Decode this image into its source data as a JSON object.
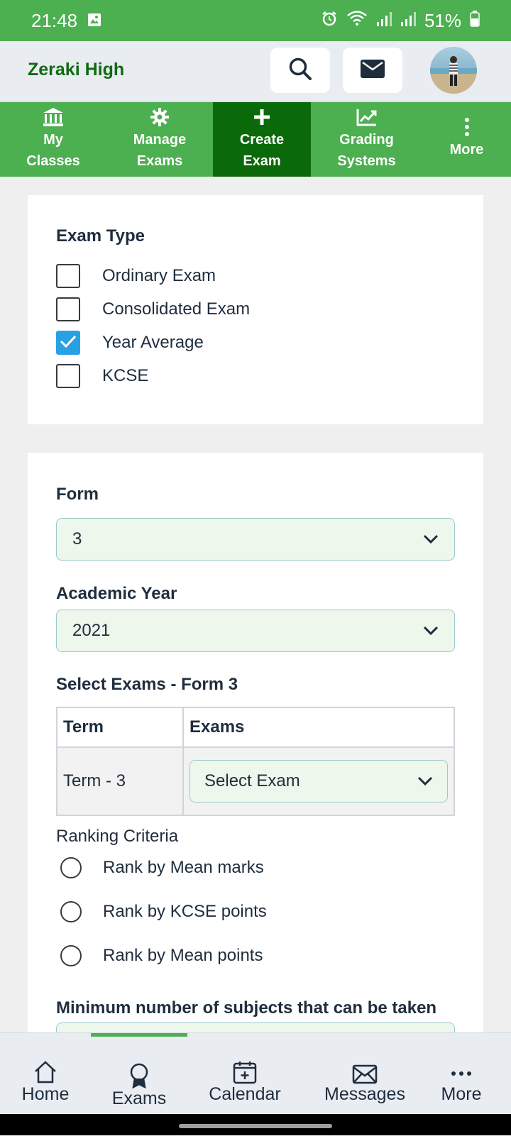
{
  "status_bar": {
    "time": "21:48",
    "battery": "51%"
  },
  "header": {
    "school_name": "Zeraki High"
  },
  "top_tabs": [
    {
      "line1": "My",
      "line2": "Classes",
      "icon": "bank-icon"
    },
    {
      "line1": "Manage",
      "line2": "Exams",
      "icon": "gear-icon"
    },
    {
      "line1": "Create",
      "line2": "Exam",
      "icon": "plus-icon",
      "active": true
    },
    {
      "line1": "Grading",
      "line2": "Systems",
      "icon": "chart-icon"
    },
    {
      "line1": "More",
      "line2": "",
      "icon": "vertical-dots-icon"
    }
  ],
  "exam_type": {
    "title": "Exam Type",
    "options": [
      {
        "label": "Ordinary Exam",
        "checked": false
      },
      {
        "label": "Consolidated Exam",
        "checked": false
      },
      {
        "label": "Year Average",
        "checked": true
      },
      {
        "label": "KCSE",
        "checked": false
      }
    ]
  },
  "form_section": {
    "form_label": "Form",
    "form_value": "3",
    "year_label": "Academic Year",
    "year_value": "2021",
    "select_exams_title": "Select Exams - Form 3",
    "table": {
      "headers": [
        "Term",
        "Exams"
      ],
      "rows": [
        {
          "term": "Term - 3",
          "exam_select": "Select Exam"
        }
      ]
    },
    "ranking_title": "Ranking Criteria",
    "ranking_options": [
      "Rank by Mean marks",
      "Rank by KCSE points",
      "Rank by Mean points"
    ],
    "min_subjects_label": "Minimum number of subjects that can be taken"
  },
  "bottom_nav": [
    {
      "label": "Home",
      "icon": "home-icon"
    },
    {
      "label": "Exams",
      "icon": "award-icon",
      "active": true
    },
    {
      "label": "Calendar",
      "icon": "calendar-icon"
    },
    {
      "label": "Messages",
      "icon": "envelope-icon"
    },
    {
      "label": "More",
      "icon": "horizontal-dots-icon"
    }
  ],
  "colors": {
    "primary_green": "#4caf50",
    "active_tab": "#0a6a0a",
    "school_name": "#0f6b12",
    "checkbox_checked": "#2aa0e4"
  }
}
